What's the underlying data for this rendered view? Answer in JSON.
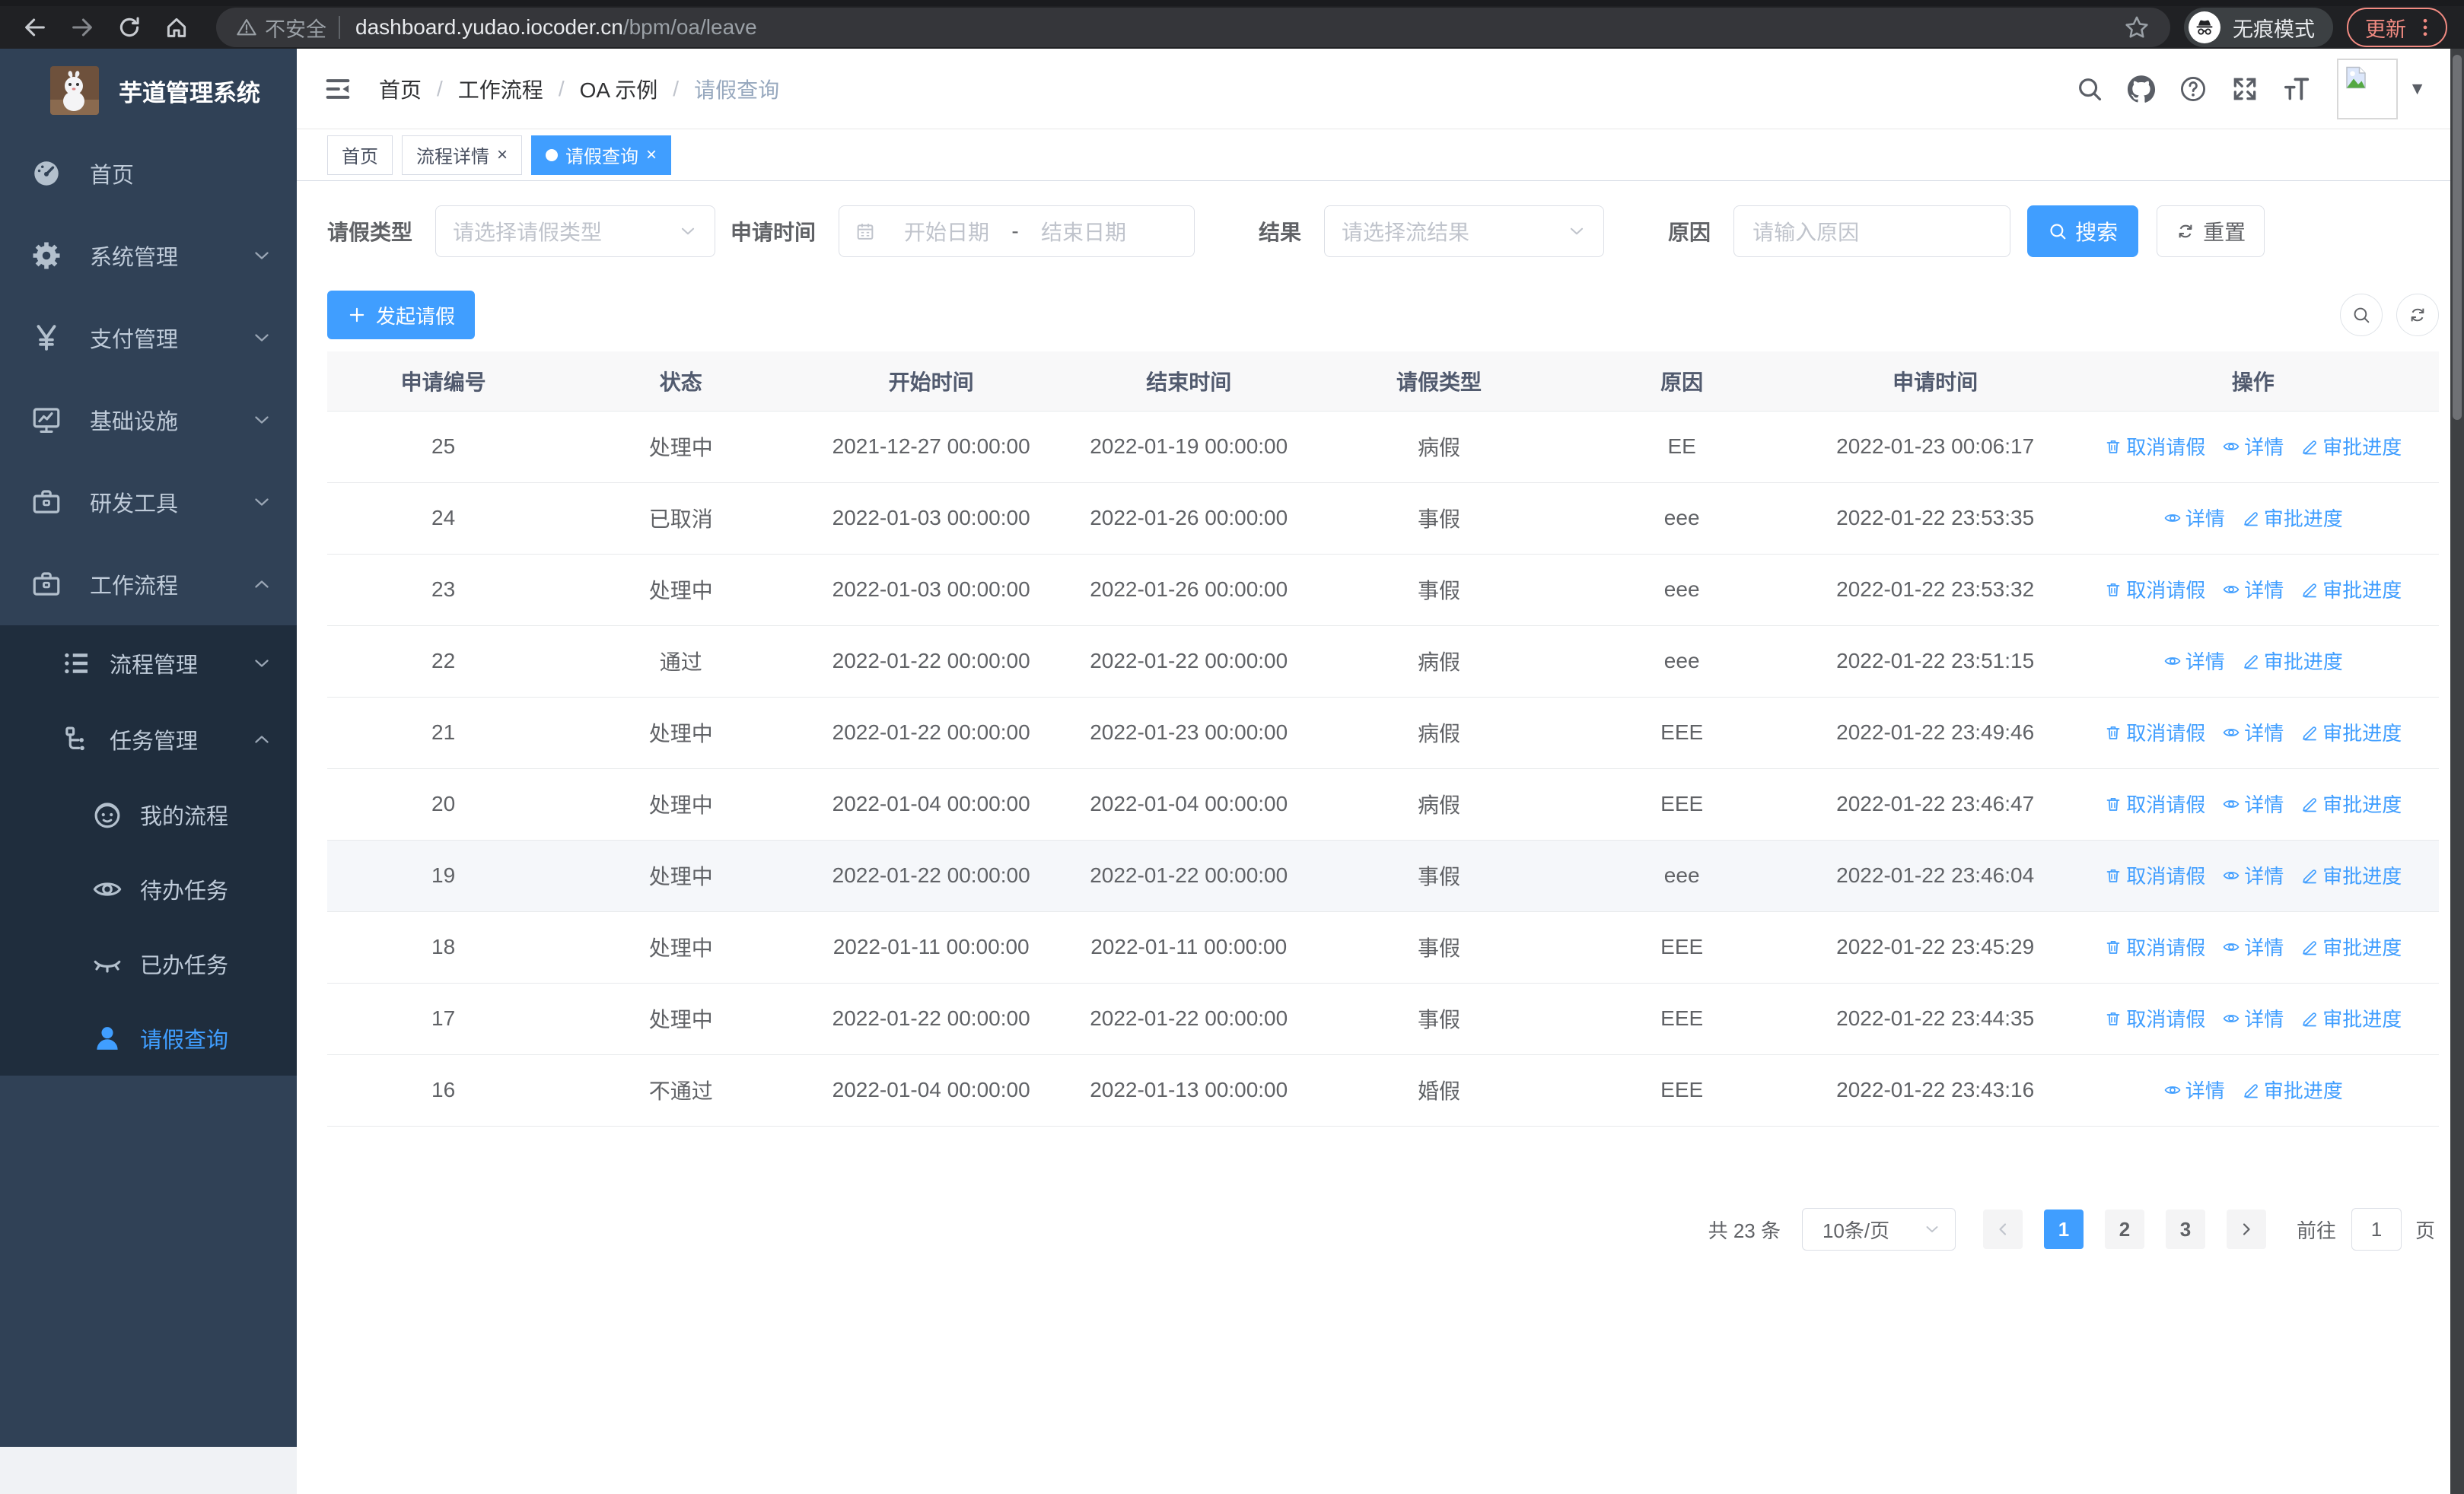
{
  "colors": {
    "primary": "#409eff",
    "sidebar_bg": "#304156",
    "submenu_bg": "#1f2d3d",
    "update_accent": "#f28b82"
  },
  "browser": {
    "security_label": "不安全",
    "url_host": "dashboard.yudao.iocoder.cn",
    "url_path": "/bpm/oa/leave",
    "incognito_label": "无痕模式",
    "update_label": "更新"
  },
  "sidebar": {
    "logo_title": "芋道管理系统",
    "items": [
      {
        "label": "首页",
        "icon": "dashboard-icon",
        "expand": null,
        "active": false
      },
      {
        "label": "系统管理",
        "icon": "gear-icon",
        "expand": "down",
        "active": false
      },
      {
        "label": "支付管理",
        "icon": "yen-icon",
        "expand": "down",
        "active": false
      },
      {
        "label": "基础设施",
        "icon": "monitor-icon",
        "expand": "down",
        "active": false
      },
      {
        "label": "研发工具",
        "icon": "toolbox-icon",
        "expand": "down",
        "active": false
      },
      {
        "label": "工作流程",
        "icon": "toolbox-icon",
        "expand": "up",
        "active": false
      }
    ],
    "submenu": [
      {
        "label": "流程管理",
        "icon": "list-icon",
        "expand": "down",
        "level": 1,
        "active": false
      },
      {
        "label": "任务管理",
        "icon": "flow-tree-icon",
        "expand": "up",
        "level": 1,
        "active": false
      },
      {
        "label": "我的流程",
        "icon": "face-icon",
        "expand": null,
        "level": 2,
        "active": false
      },
      {
        "label": "待办任务",
        "icon": "eye-open-icon",
        "expand": null,
        "level": 2,
        "active": false
      },
      {
        "label": "已办任务",
        "icon": "eye-closed-icon",
        "expand": null,
        "level": 2,
        "active": false
      },
      {
        "label": "请假查询",
        "icon": "user-icon",
        "expand": null,
        "level": 2,
        "active": true
      }
    ]
  },
  "header": {
    "breadcrumb": [
      "首页",
      "工作流程",
      "OA 示例",
      "请假查询"
    ]
  },
  "tabs": [
    {
      "label": "首页",
      "active": false,
      "closable": false
    },
    {
      "label": "流程详情",
      "active": false,
      "closable": true
    },
    {
      "label": "请假查询",
      "active": true,
      "closable": true
    }
  ],
  "filters": {
    "type_label": "请假类型",
    "type_placeholder": "请选择请假类型",
    "time_label": "申请时间",
    "time_start_placeholder": "开始日期",
    "time_separator": "-",
    "time_end_placeholder": "结束日期",
    "result_label": "结果",
    "result_placeholder": "请选择流结果",
    "reason_label": "原因",
    "reason_placeholder": "请输入原因",
    "search_label": "搜索",
    "reset_label": "重置"
  },
  "toolbar": {
    "create_label": "发起请假"
  },
  "table": {
    "columns": [
      "申请编号",
      "状态",
      "开始时间",
      "结束时间",
      "请假类型",
      "原因",
      "申请时间",
      "操作"
    ],
    "action_labels": {
      "cancel": "取消请假",
      "detail": "详情",
      "progress": "审批进度"
    },
    "rows": [
      {
        "id": "25",
        "status": "处理中",
        "start": "2021-12-27 00:00:00",
        "end": "2022-01-19 00:00:00",
        "type": "病假",
        "reason": "EE",
        "apply_time": "2022-01-23 00:06:17",
        "actions": [
          "cancel",
          "detail",
          "progress"
        ],
        "highlighted": false
      },
      {
        "id": "24",
        "status": "已取消",
        "start": "2022-01-03 00:00:00",
        "end": "2022-01-26 00:00:00",
        "type": "事假",
        "reason": "eee",
        "apply_time": "2022-01-22 23:53:35",
        "actions": [
          "detail",
          "progress"
        ],
        "highlighted": false
      },
      {
        "id": "23",
        "status": "处理中",
        "start": "2022-01-03 00:00:00",
        "end": "2022-01-26 00:00:00",
        "type": "事假",
        "reason": "eee",
        "apply_time": "2022-01-22 23:53:32",
        "actions": [
          "cancel",
          "detail",
          "progress"
        ],
        "highlighted": false
      },
      {
        "id": "22",
        "status": "通过",
        "start": "2022-01-22 00:00:00",
        "end": "2022-01-22 00:00:00",
        "type": "病假",
        "reason": "eee",
        "apply_time": "2022-01-22 23:51:15",
        "actions": [
          "detail",
          "progress"
        ],
        "highlighted": false
      },
      {
        "id": "21",
        "status": "处理中",
        "start": "2022-01-22 00:00:00",
        "end": "2022-01-23 00:00:00",
        "type": "病假",
        "reason": "EEE",
        "apply_time": "2022-01-22 23:49:46",
        "actions": [
          "cancel",
          "detail",
          "progress"
        ],
        "highlighted": false
      },
      {
        "id": "20",
        "status": "处理中",
        "start": "2022-01-04 00:00:00",
        "end": "2022-01-04 00:00:00",
        "type": "病假",
        "reason": "EEE",
        "apply_time": "2022-01-22 23:46:47",
        "actions": [
          "cancel",
          "detail",
          "progress"
        ],
        "highlighted": false
      },
      {
        "id": "19",
        "status": "处理中",
        "start": "2022-01-22 00:00:00",
        "end": "2022-01-22 00:00:00",
        "type": "事假",
        "reason": "eee",
        "apply_time": "2022-01-22 23:46:04",
        "actions": [
          "cancel",
          "detail",
          "progress"
        ],
        "highlighted": true
      },
      {
        "id": "18",
        "status": "处理中",
        "start": "2022-01-11 00:00:00",
        "end": "2022-01-11 00:00:00",
        "type": "事假",
        "reason": "EEE",
        "apply_time": "2022-01-22 23:45:29",
        "actions": [
          "cancel",
          "detail",
          "progress"
        ],
        "highlighted": false
      },
      {
        "id": "17",
        "status": "处理中",
        "start": "2022-01-22 00:00:00",
        "end": "2022-01-22 00:00:00",
        "type": "事假",
        "reason": "EEE",
        "apply_time": "2022-01-22 23:44:35",
        "actions": [
          "cancel",
          "detail",
          "progress"
        ],
        "highlighted": false
      },
      {
        "id": "16",
        "status": "不通过",
        "start": "2022-01-04 00:00:00",
        "end": "2022-01-13 00:00:00",
        "type": "婚假",
        "reason": "EEE",
        "apply_time": "2022-01-22 23:43:16",
        "actions": [
          "detail",
          "progress"
        ],
        "highlighted": false
      }
    ]
  },
  "pagination": {
    "total_label": "共 23 条",
    "page_size": "10条/页",
    "pages": [
      "1",
      "2",
      "3"
    ],
    "active_page": "1",
    "goto_label": "前往",
    "goto_value": "1",
    "goto_suffix": "页"
  }
}
